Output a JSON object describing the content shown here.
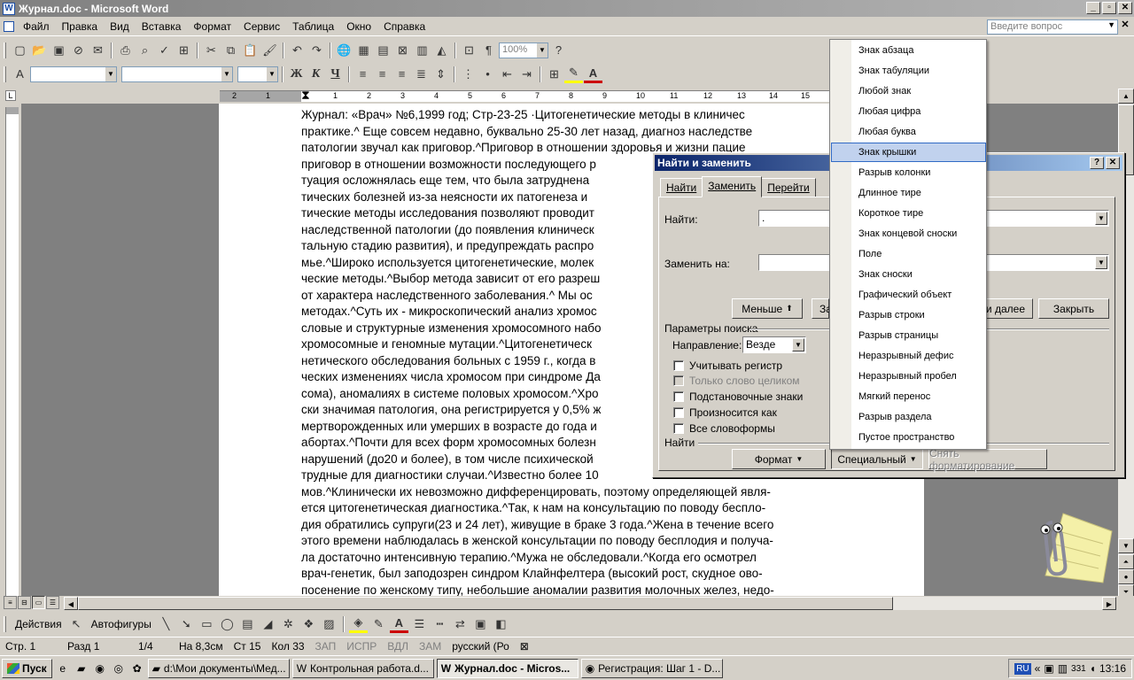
{
  "window": {
    "title": "Журнал.doc - Microsoft Word",
    "app_icon": "W"
  },
  "menubar": {
    "items": [
      "Файл",
      "Правка",
      "Вид",
      "Вставка",
      "Формат",
      "Сервис",
      "Таблица",
      "Окно",
      "Справка"
    ],
    "ask_placeholder": "Введите вопрос"
  },
  "toolbar": {
    "zoom": "100%"
  },
  "ruler": {
    "numbers": [
      "2",
      "1",
      "1",
      "2",
      "3",
      "4",
      "5",
      "6",
      "7",
      "8",
      "9",
      "10",
      "11",
      "12",
      "13",
      "14",
      "15"
    ]
  },
  "document": {
    "lines": [
      "Журнал: «Врач» №6,1999 год; Стр-23-25 ·Цитогенетические методы в клиничес",
      "практике.^ Еще совсем недавно, буквально 25-30 лет назад, диагноз наследстве",
      "патологии звучал как приговор.^Приговор в отношении здоровья и жизни пацие",
      "приговор в отношении возможности последующего р",
      "туация осложнялась еще тем, что была затруднена",
      "тических болезней из-за неясности их патогенеза и",
      "тические методы исследования позволяют проводит",
      "наследственной патологии (до появления клиническ",
      "тальную стадию развития), и предупреждать распро",
      "мье.^Широко используется цитогенетические, молек",
      "ческие методы.^Выбор метода зависит от его разреш",
      "от характера наследственного заболевания.^ Мы ос",
      "методах.^Суть их - микроскопический анализ хромос",
      "словые и структурные изменения хромосомного набо",
      "хромосомные и геномные мутации.^Цитогенетическ",
      "нетического обследования больных с 1959 г., когда в",
      "ческих изменениях числа хромосом при синдроме Да",
      "сома), аномалиях в системе половых хромосом.^Хро",
      "ски значимая патология, она регистрируется у 0,5% ж",
      "мертворожденных или умерших в возрасте до года и",
      "абортах.^Почти для всех форм хромосомных болезн",
      "нарушений (до20 и более), в том числе психической",
      "трудные для диагностики случаи.^Известно более 10",
      "мов.^Клинически их невозможно дифференцировать, поэтому определяющей явля-",
      "ется цитогенетическая диагностика.^Так, к нам на консультацию по поводу беспло-",
      "дия обратились супруги(23 и 24 лет), живущие в браке 3 года.^Жена в течение всего",
      "этого времени наблюдалась в женской консультации по поводу бесплодия и получа-",
      "ла достаточно интенсивную терапию.^Мужа не обследовали.^Когда его осмотрел",
      "врач-генетик, был заподозрен синдром Клайнфелтера (высокий рост, скудное ово-",
      "посенение по женскому типу, небольшие аномалии развития молочных желез, недо-"
    ]
  },
  "dialog": {
    "title": "Найти и заменить",
    "tabs": [
      "Найти",
      "Заменить",
      "Перейти"
    ],
    "find_label": "Найти:",
    "find_value": ".",
    "replace_label": "Заменить на:",
    "replace_value": "",
    "less_button": "Меньше",
    "replace_button_partial": "За",
    "find_next_partial": "ти далее",
    "close_button": "Закрыть",
    "search_params_label": "Параметры поиска",
    "direction_label": "Направление:",
    "direction_value": "Везде",
    "checkboxes": [
      {
        "label": "Учитывать регистр",
        "enabled": true
      },
      {
        "label": "Только слово целиком",
        "enabled": false
      },
      {
        "label": "Подстановочные знаки",
        "enabled": true
      },
      {
        "label": "Произносится как",
        "enabled": true
      },
      {
        "label": "Все словоформы",
        "enabled": true
      }
    ],
    "find_section_label": "Найти",
    "format_button": "Формат",
    "special_button": "Специальный",
    "clear_format_button": "Снять форматирование"
  },
  "special_menu": {
    "items": [
      "Знак абзаца",
      "Знак табуляции",
      "Любой знак",
      "Любая цифра",
      "Любая буква",
      "Знак крышки",
      "Разрыв колонки",
      "Длинное тире",
      "Короткое тире",
      "Знак концевой сноски",
      "Поле",
      "Знак сноски",
      "Графический объект",
      "Разрыв строки",
      "Разрыв страницы",
      "Неразрывный дефис",
      "Неразрывный пробел",
      "Мягкий перенос",
      "Разрыв раздела",
      "Пустое пространство"
    ],
    "highlighted": "Знак крышки"
  },
  "drawbar": {
    "actions": "Действия",
    "autoshapes": "Автофигуры"
  },
  "statusbar": {
    "page": "Стр. 1",
    "section": "Разд 1",
    "pages": "1/4",
    "at": "На 8,3см",
    "line": "Ст 15",
    "col": "Кол 33",
    "rec": "ЗАП",
    "trk": "ИСПР",
    "ext": "ВДЛ",
    "ovr": "ЗАМ",
    "language": "русский (Ро"
  },
  "taskbar": {
    "start": "Пуск",
    "tasks": [
      "d:\\Мои документы\\Мед...",
      "Контрольная работа.d...",
      "Журнал.doc - Micros...",
      "Регистрация: Шаг 1 - D..."
    ],
    "active_task": "Журнал.doc - Micros...",
    "lang": "RU",
    "tray_count": "331",
    "clock": "13:16"
  }
}
